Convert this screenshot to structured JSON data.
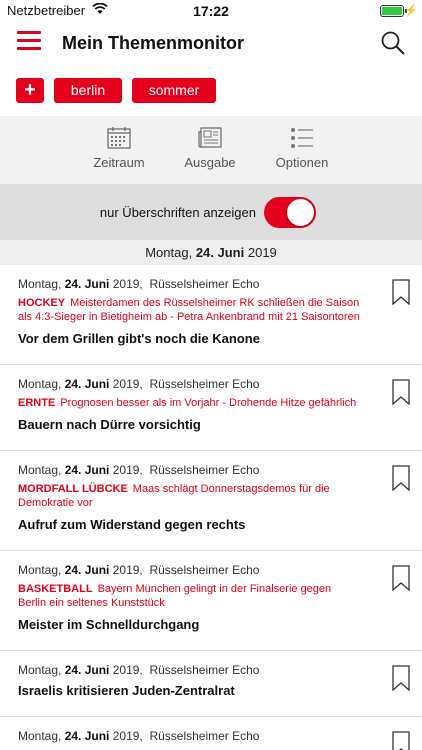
{
  "status": {
    "carrier": "Netzbetreiber",
    "time": "17:22",
    "battery_level": 1.0,
    "battery_color": "#2ecc40"
  },
  "nav": {
    "title": "Mein Themenmonitor"
  },
  "tags": {
    "add_label": "+",
    "items": [
      "berlin",
      "sommer"
    ]
  },
  "toolbar": {
    "items": [
      {
        "label": "Zeitraum",
        "icon": "calendar-icon"
      },
      {
        "label": "Ausgabe",
        "icon": "newspaper-icon"
      },
      {
        "label": "Optionen",
        "icon": "list-icon"
      }
    ]
  },
  "toggle": {
    "label": "nur Überschriften anzeigen",
    "on": true
  },
  "date_header": {
    "weekday": "Montag,",
    "day_month": "24. Juni",
    "year": "2019"
  },
  "colors": {
    "accent": "#e2001a"
  },
  "articles": [
    {
      "weekday": "Montag,",
      "day_month": "24. Juni",
      "year": "2019,",
      "source": "Rüsselsheimer Echo",
      "kicker_kw": "HOCKEY",
      "kicker": "Meisterdamen des Rüsselsheimer RK schließen die Saison als 4:3-Sieger in Bietigheim ab - Petra Ankenbrand mit 21 Saisontoren",
      "headline": "Vor dem Grillen gibt's noch die Kanone"
    },
    {
      "weekday": "Montag,",
      "day_month": "24. Juni",
      "year": "2019,",
      "source": "Rüsselsheimer Echo",
      "kicker_kw": "ERNTE",
      "kicker": "Prognosen besser als im Vorjahr - Drohende Hitze gefährlich",
      "headline": "Bauern nach Dürre vorsichtig"
    },
    {
      "weekday": "Montag,",
      "day_month": "24. Juni",
      "year": "2019,",
      "source": "Rüsselsheimer Echo",
      "kicker_kw": "MORDFALL LÜBCKE",
      "kicker": "Maas schlägt Donnerstagsdemos für die Demokratie vor",
      "headline": "Aufruf zum Widerstand gegen rechts"
    },
    {
      "weekday": "Montag,",
      "day_month": "24. Juni",
      "year": "2019,",
      "source": "Rüsselsheimer Echo",
      "kicker_kw": "BASKETBALL",
      "kicker": "Bayern München gelingt in der Finalserie gegen Berlin ein seltenes Kunststück",
      "headline": "Meister im Schnelldurchgang"
    },
    {
      "weekday": "Montag,",
      "day_month": "24. Juni",
      "year": "2019,",
      "source": "Rüsselsheimer Echo",
      "kicker_kw": "",
      "kicker": "",
      "headline": "Israelis kritisieren Juden-Zentralrat"
    },
    {
      "weekday": "Montag,",
      "day_month": "24. Juni",
      "year": "2019,",
      "source": "Rüsselsheimer Echo",
      "kicker_kw": "",
      "kicker": "",
      "headline": ""
    }
  ]
}
